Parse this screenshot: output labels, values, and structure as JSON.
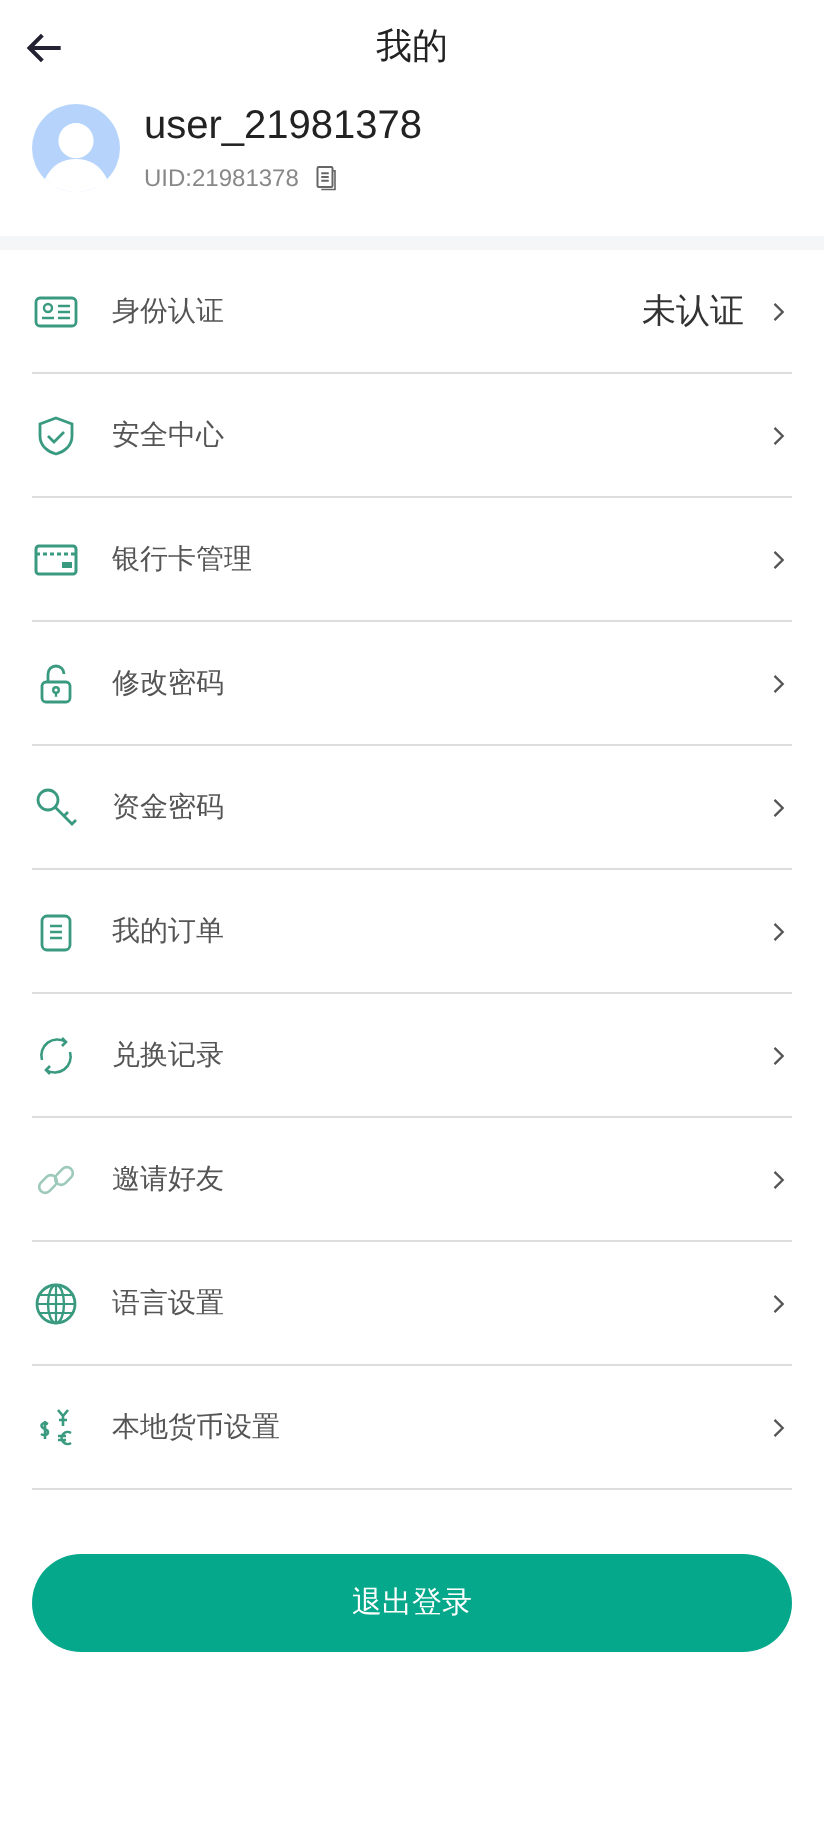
{
  "header": {
    "title": "我的"
  },
  "profile": {
    "username": "user_21981378",
    "uid": "UID:21981378"
  },
  "menu": [
    {
      "label": "身份认证",
      "value": "未认证"
    },
    {
      "label": "安全中心"
    },
    {
      "label": "银行卡管理"
    },
    {
      "label": "修改密码"
    },
    {
      "label": "资金密码"
    },
    {
      "label": "我的订单"
    },
    {
      "label": "兑换记录"
    },
    {
      "label": "邀请好友"
    },
    {
      "label": "语言设置"
    },
    {
      "label": "本地货币设置"
    }
  ],
  "logout_button": "退出登录"
}
